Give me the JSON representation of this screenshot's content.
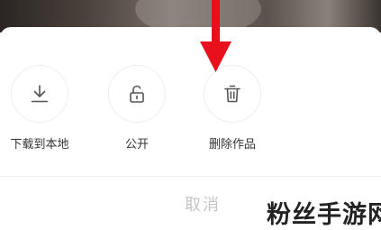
{
  "share_sheet": {
    "actions": [
      {
        "label": "下载到本地",
        "icon": "download-icon"
      },
      {
        "label": "公开",
        "icon": "unlock-icon"
      },
      {
        "label": "删除作品",
        "icon": "trash-icon"
      }
    ],
    "cancel_label": "取消"
  },
  "watermark": {
    "text": "粉丝手游网"
  },
  "colors": {
    "annotation_arrow": "#e8101b",
    "icon_stroke": "#555555",
    "label_text": "#333333",
    "cancel_text": "#c4c4c4"
  }
}
